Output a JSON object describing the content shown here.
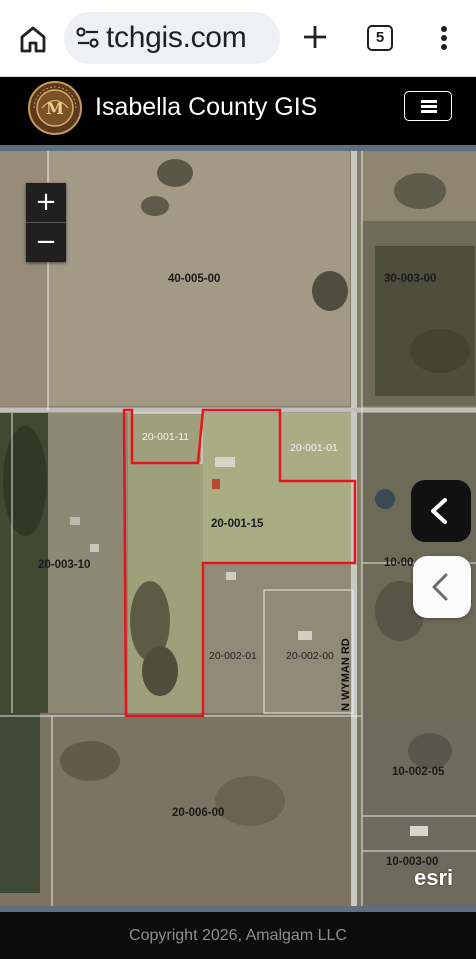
{
  "browser": {
    "url": "tchgis.com",
    "tab_count": "5",
    "icons": {
      "home": "home-icon",
      "site_info": "tune-icon",
      "new_tab": "plus-icon",
      "tabs": "tab-switcher-icon",
      "menu": "kebab-menu-icon"
    }
  },
  "header": {
    "title": "Isabella County GIS",
    "seal_text": "ISABELLA COUNTY MICHIGAN",
    "menu_icon": "hamburger-icon"
  },
  "map": {
    "zoom_in": "+",
    "zoom_out": "−",
    "attribution": "esri",
    "road_label": "N WYMAN RD",
    "selected_parcel_color": "#e8141b",
    "parcels": [
      {
        "id": "40-005-00",
        "style": "bold"
      },
      {
        "id": "30-003-00",
        "style": "bold"
      },
      {
        "id": "20-001-11",
        "style": "light"
      },
      {
        "id": "20-001-01",
        "style": "light"
      },
      {
        "id": "20-001-15",
        "style": "bold"
      },
      {
        "id": "20-003-10",
        "style": "bold"
      },
      {
        "id": "10-00",
        "style": "bold"
      },
      {
        "id": "20-002-01",
        "style": "light"
      },
      {
        "id": "20-002-00",
        "style": "light"
      },
      {
        "id": "10-002-05",
        "style": "bold"
      },
      {
        "id": "20-006-00",
        "style": "bold"
      },
      {
        "id": "10-003-00",
        "style": "bold"
      }
    ],
    "panel_toggle_icon": "chevron-left-icon"
  },
  "footer": {
    "copyright": "Copyright 2026, Amalgam LLC"
  }
}
